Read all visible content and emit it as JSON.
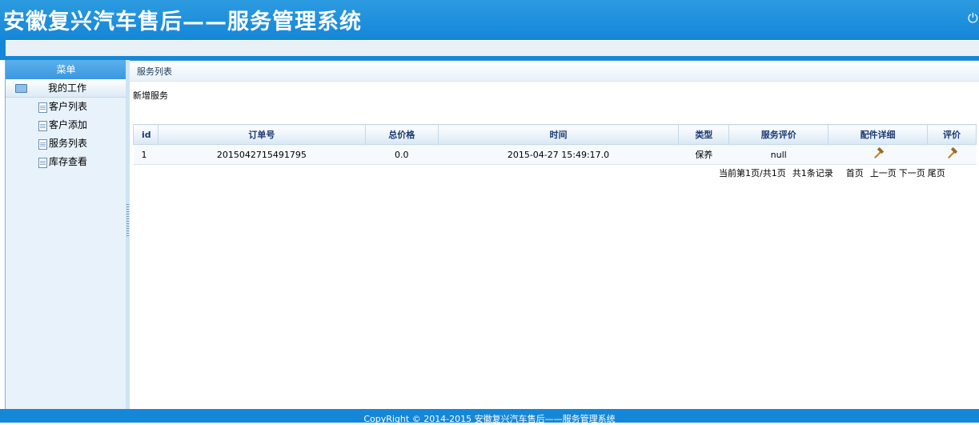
{
  "header": {
    "title": "安徽复兴汽车售后——服务管理系统",
    "power_icon": "power-icon"
  },
  "menu": {
    "header": "菜单",
    "group_label": "我的工作",
    "items": [
      {
        "label": "客户列表"
      },
      {
        "label": "客户添加"
      },
      {
        "label": "服务列表"
      },
      {
        "label": "库存查看"
      }
    ]
  },
  "main": {
    "breadcrumb": "服务列表",
    "add_link": "新增服务",
    "table": {
      "columns": [
        "id",
        "订单号",
        "总价格",
        "时间",
        "类型",
        "服务评价",
        "配件详细",
        "评价"
      ],
      "rows": [
        {
          "id": "1",
          "order_no": "2015042715491795",
          "total_price": "0.0",
          "time": "2015-04-27 15:49:17.0",
          "type": "保养",
          "evaluation": "null"
        }
      ]
    },
    "pager": {
      "status": "当前第1页/共1页",
      "total": "共1条记录",
      "first": "首页",
      "prev": "上一页",
      "next": "下一页",
      "last": "尾页"
    }
  },
  "footer": {
    "copyright": "CopyRight © 2014-2015 安徽复兴汽车售后——服务管理系统"
  },
  "colors": {
    "header_blue": "#1587d8",
    "menu_bg": "#e8f2fb",
    "table_header_text": "#1b3a73"
  }
}
